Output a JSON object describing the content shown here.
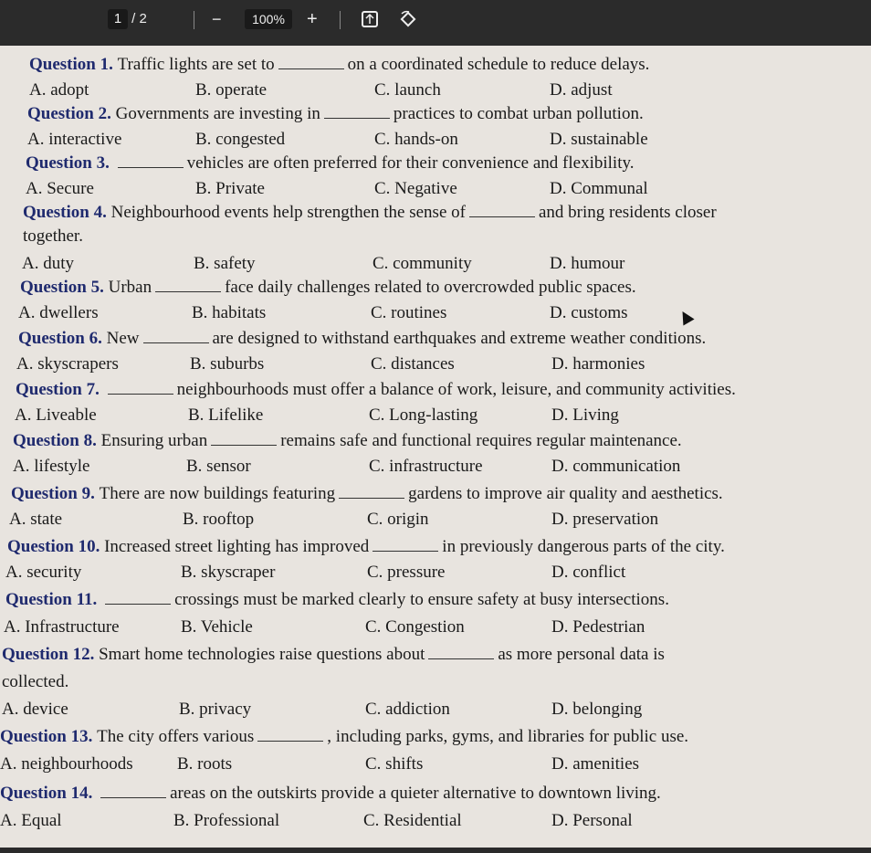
{
  "toolbar": {
    "page_current": "1",
    "page_sep": "/",
    "page_total": "2",
    "zoom_out": "−",
    "zoom": "100%",
    "zoom_in": "+"
  },
  "questions": [
    {
      "label": "Question 1.",
      "pre": "Traffic lights are set to",
      "post": "on a coordinated schedule to reduce delays.",
      "opts": [
        "A. adopt",
        "B. operate",
        "C. launch",
        "D. adjust"
      ]
    },
    {
      "label": "Question 2.",
      "pre": "Governments are investing in",
      "post": "practices to combat urban pollution.",
      "opts": [
        "A. interactive",
        "B. congested",
        "C. hands-on",
        "D. sustainable"
      ]
    },
    {
      "label": "Question 3.",
      "pre": "",
      "post": "vehicles are often preferred for their convenience and flexibility.",
      "opts": [
        "A. Secure",
        "B. Private",
        "C. Negative",
        "D. Communal"
      ]
    },
    {
      "label": "Question 4.",
      "pre": "Neighbourhood events help strengthen the sense of",
      "post": "and bring residents closer",
      "post2": "together.",
      "opts": [
        "A. duty",
        "B. safety",
        "C. community",
        "D. humour"
      ]
    },
    {
      "label": "Question 5.",
      "pre": "Urban",
      "post": "face daily challenges related to overcrowded public spaces.",
      "opts": [
        "A. dwellers",
        "B. habitats",
        "C. routines",
        "D. customs"
      ]
    },
    {
      "label": "Question 6.",
      "pre": "New",
      "post": "are designed to withstand earthquakes and extreme weather conditions.",
      "opts": [
        "A. skyscrapers",
        "B. suburbs",
        "C. distances",
        "D. harmonies"
      ]
    },
    {
      "label": "Question 7.",
      "pre": "",
      "post": "neighbourhoods must offer a balance of work, leisure, and community activities.",
      "opts": [
        "A. Liveable",
        "B. Lifelike",
        "C. Long-lasting",
        "D. Living"
      ]
    },
    {
      "label": "Question 8.",
      "pre": "Ensuring urban",
      "post": "remains safe and functional requires regular maintenance.",
      "opts": [
        "A. lifestyle",
        "B. sensor",
        "C. infrastructure",
        "D. communication"
      ]
    },
    {
      "label": "Question 9.",
      "pre": "There are now buildings featuring",
      "post": "gardens to improve air quality and aesthetics.",
      "opts": [
        "A. state",
        "B. rooftop",
        "C. origin",
        "D. preservation"
      ]
    },
    {
      "label": "Question 10.",
      "pre": "Increased street lighting has improved",
      "post": "in previously dangerous parts of the city.",
      "opts": [
        "A. security",
        "B. skyscraper",
        "C. pressure",
        "D. conflict"
      ]
    },
    {
      "label": "Question 11.",
      "pre": "",
      "post": "crossings must be marked clearly to ensure safety at busy intersections.",
      "opts": [
        "A. Infrastructure",
        "B. Vehicle",
        "C. Congestion",
        "D. Pedestrian"
      ]
    },
    {
      "label": "Question 12.",
      "pre": "Smart home technologies raise questions about",
      "post": "as more personal data is",
      "post2": "collected.",
      "opts": [
        "A. device",
        "B. privacy",
        "C. addiction",
        "D. belonging"
      ]
    },
    {
      "label": "Question 13.",
      "pre": "The city offers various",
      "post": ", including parks, gyms, and libraries for public use.",
      "opts": [
        "A. neighbourhoods",
        "B. roots",
        "C. shifts",
        "D. amenities"
      ]
    },
    {
      "label": "Question 14.",
      "pre": "",
      "post": "areas on the outskirts provide a quieter alternative to downtown living.",
      "opts": [
        "A. Equal",
        "B. Professional",
        "C. Residential",
        "D. Personal"
      ]
    }
  ]
}
